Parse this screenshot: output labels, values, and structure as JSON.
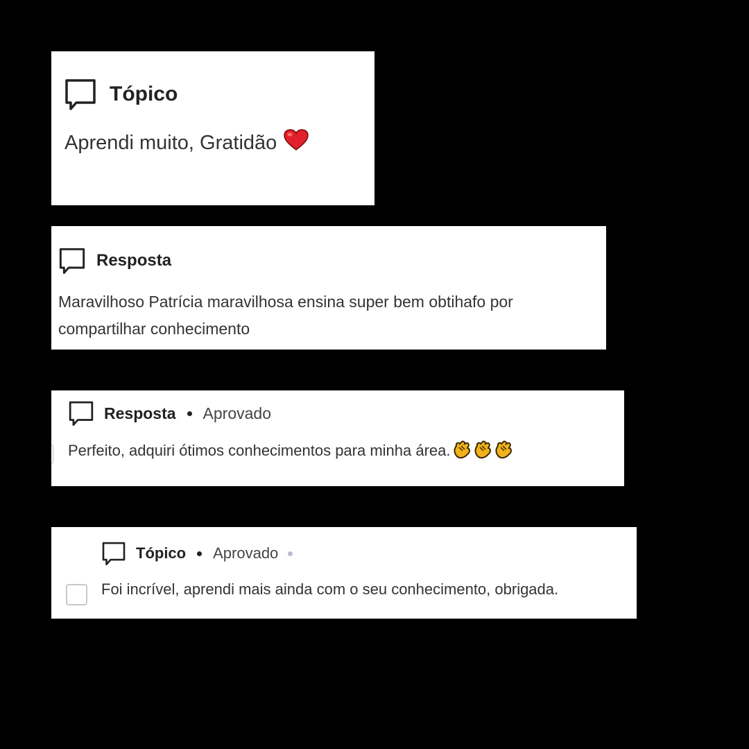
{
  "cards": [
    {
      "icon": "chat-bubble-icon",
      "kind": "Tópico",
      "text": "Aprendi muito, Gratidão",
      "emoji": "heart-icon"
    },
    {
      "icon": "chat-bubble-icon",
      "kind": "Resposta",
      "text": "Maravilhoso Patrícia maravilhosa ensina super bem obtihafo por compartilhar conhecimento"
    },
    {
      "icon": "chat-bubble-icon",
      "kind": "Resposta",
      "status": "Aprovado",
      "text": "Perfeito, adquiri ótimos conhecimentos para minha área.",
      "emoji": "clapping-hands-icon",
      "emoji_count": 3
    },
    {
      "icon": "chat-bubble-icon",
      "kind": "Tópico",
      "status": "Aprovado",
      "text": "Foi incrível, aprendi mais ainda com o seu conhecimento, obrigada.",
      "checkbox_checked": false
    }
  ],
  "colors": {
    "background": "#000000",
    "card": "#ffffff",
    "heart": "#e0202a",
    "clap": "#f2b21c"
  }
}
